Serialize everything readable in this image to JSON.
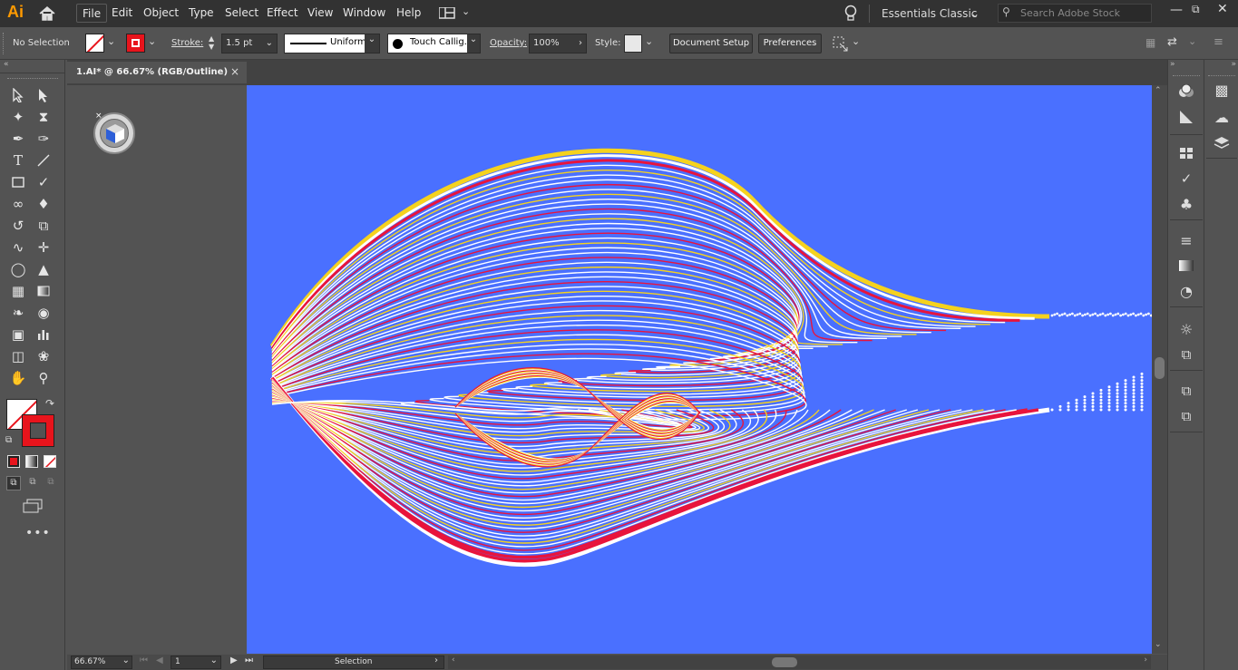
{
  "app": {
    "logo": "Ai",
    "logo_color": "#ff9a00"
  },
  "menu": [
    "File",
    "Edit",
    "Object",
    "Type",
    "Select",
    "Effect",
    "View",
    "Window",
    "Help"
  ],
  "workspace": "Essentials Classic",
  "search_placeholder": "Search Adobe Stock",
  "control": {
    "selection": "No Selection",
    "stroke_label": "Stroke:",
    "stroke_weight": "1.5 pt",
    "variable_width": "Uniform",
    "brush": "Touch Callig...",
    "opacity_label": "Opacity:",
    "opacity": "100%",
    "style_label": "Style:",
    "document_setup": "Document Setup",
    "preferences": "Preferences"
  },
  "document_tab": {
    "title": "1.AI* @ 66.67% (RGB/Outline)",
    "close": "×"
  },
  "status": {
    "zoom": "66.67%",
    "artboard": "1",
    "tool": "Selection"
  },
  "colors": {
    "canvas": "#4a70ff",
    "fill_swatch": "#e8141c",
    "lines": [
      "#ffffff",
      "#f5d21e",
      "#e8143c"
    ]
  },
  "icons": {
    "cube": "view-cube-icon",
    "home": "home-icon",
    "lightbulb": "lightbulb-icon",
    "search": "search-icon"
  }
}
